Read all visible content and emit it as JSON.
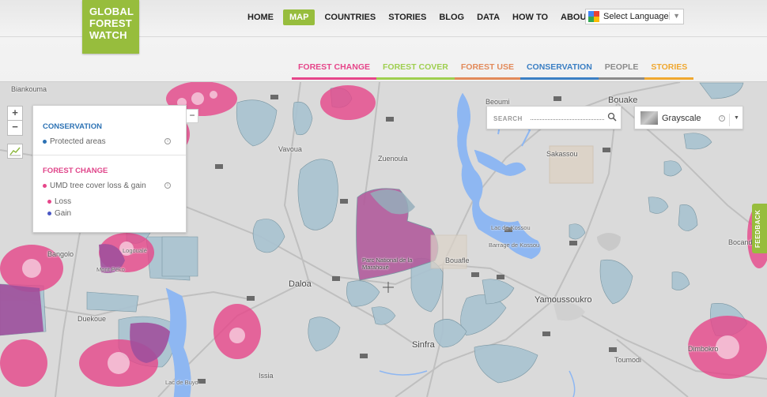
{
  "logo": {
    "line1": "GLOBAL",
    "line2": "FOREST",
    "line3": "WATCH"
  },
  "top_nav": [
    {
      "label": "HOME",
      "active": false
    },
    {
      "label": "MAP",
      "active": true
    },
    {
      "label": "COUNTRIES",
      "active": false
    },
    {
      "label": "STORIES",
      "active": false
    },
    {
      "label": "BLOG",
      "active": false
    },
    {
      "label": "DATA",
      "active": false
    },
    {
      "label": "HOW TO",
      "active": false
    },
    {
      "label": "ABOUT",
      "active": false
    }
  ],
  "language": {
    "label": "Select Language",
    "arrow": "▼"
  },
  "category_nav": [
    {
      "label": "FOREST CHANGE",
      "color": "#e6468a"
    },
    {
      "label": "FOREST COVER",
      "color": "#9fcf50"
    },
    {
      "label": "FOREST USE",
      "color": "#e28a5a"
    },
    {
      "label": "CONSERVATION",
      "color": "#3b7fc4"
    },
    {
      "label": "PEOPLE",
      "color": "#8b8b8b"
    },
    {
      "label": "STORIES",
      "color": "#f0a830"
    }
  ],
  "map_controls": {
    "zoom_in": "+",
    "zoom_out": "−"
  },
  "legend": {
    "close": "−",
    "conservation": {
      "title": "CONSERVATION",
      "title_color": "#2c72b4",
      "layers": [
        {
          "label": "Protected areas",
          "color": "#2c72b4",
          "info": "i"
        }
      ]
    },
    "forest_change": {
      "title": "FOREST CHANGE",
      "title_color": "#e0458a",
      "layers": [
        {
          "label": "UMD tree cover loss & gain",
          "color": "#e6468a",
          "info": "i"
        }
      ],
      "sublegend": [
        {
          "label": "Loss",
          "color": "#e6468a"
        },
        {
          "label": "Gain",
          "color": "#4a57c4"
        }
      ]
    }
  },
  "search": {
    "placeholder": "SEARCH"
  },
  "basemap": {
    "label": "Grayscale",
    "info": "i",
    "arrow": "▼"
  },
  "feedback": {
    "label": "FEEDBACK"
  },
  "places": [
    {
      "name": "Biankouma"
    },
    {
      "name": "Bouake"
    },
    {
      "name": "Beoumi"
    },
    {
      "name": "Vavoua"
    },
    {
      "name": "Zuenoula"
    },
    {
      "name": "Sakassou"
    },
    {
      "name": "Lac de Kossou"
    },
    {
      "name": "Barrage de Kossou"
    },
    {
      "name": "Bouafle"
    },
    {
      "name": "Bocanda"
    },
    {
      "name": "Bangolo"
    },
    {
      "name": "Logoualé"
    },
    {
      "name": "Mont Péko"
    },
    {
      "name": "Duekoue"
    },
    {
      "name": "Daloa"
    },
    {
      "name": "Yamoussoukro"
    },
    {
      "name": "Sinfra"
    },
    {
      "name": "Dimbokro"
    },
    {
      "name": "Toumodi"
    },
    {
      "name": "Issia"
    },
    {
      "name": "Lac de Buyo"
    },
    {
      "name": "Parc National de la Marahoué"
    }
  ],
  "colors": {
    "accent": "#97bd3d",
    "protected_area": "#a9c3d1",
    "water": "#8eb7f2",
    "loss": "#e6468a",
    "gain": "#4a57c4"
  }
}
